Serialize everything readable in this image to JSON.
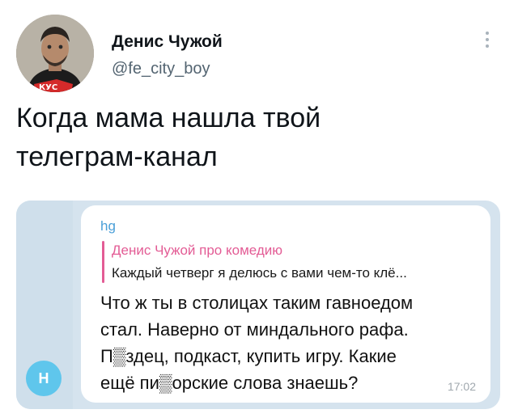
{
  "tweet": {
    "author_name": "Денис Чужой",
    "author_handle": "@fe_city_boy",
    "text": "Когда мама нашла твой\nтелеграм-канал"
  },
  "embed": {
    "avatar_letter": "H",
    "sender_name": "hg",
    "reply": {
      "author": "Денис Чужой про комедию",
      "text": "Каждый четверг я делюсь с вами чем-то клё..."
    },
    "message": "Что ж ты в столицах таким гавноедом\nстал. Наверно от миндального рафа.\nП▒здец, подкаст, купить игру. Какие\nещё пи▒орские слова знаешь?",
    "time": "17:02"
  },
  "colors": {
    "handle": "#536471",
    "telegram_bg": "#d5e3ee",
    "sender": "#4a9fd8",
    "reply_accent": "#e35c95",
    "avatar_accent": "#5fc6ec"
  }
}
